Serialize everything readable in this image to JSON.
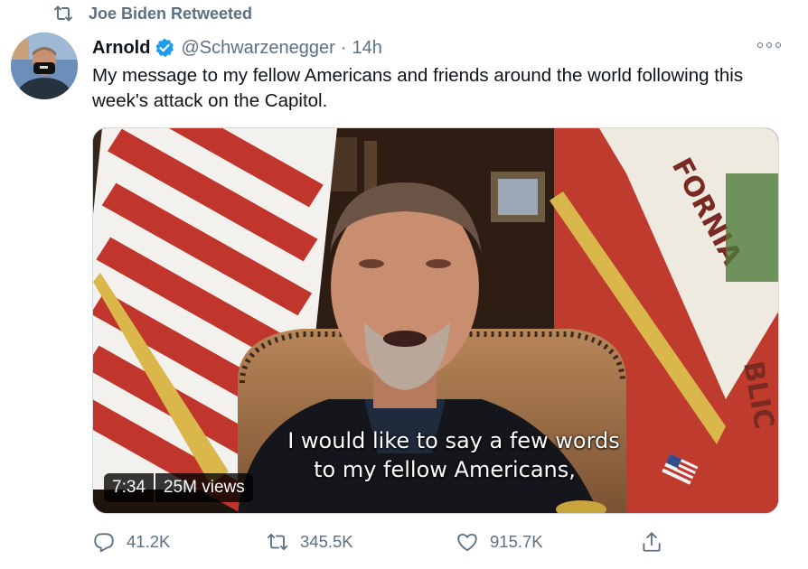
{
  "retweet_context": {
    "icon": "retweet-icon",
    "text": "Joe Biden Retweeted"
  },
  "tweet": {
    "display_name": "Arnold",
    "verified": true,
    "handle": "@Schwarzenegger",
    "separator": "·",
    "time": "14h",
    "text": "My message to my fellow Americans and friends around the world following this week's attack on the Capitol."
  },
  "video": {
    "subtitle_line1": "I would like to say a few words",
    "subtitle_line2": "to my fellow Americans,",
    "flag_banner_text": "FORNIA",
    "flag_banner_text2": "BLIC",
    "duration": "7:34",
    "views": "25M views"
  },
  "actions": {
    "replies": "41.2K",
    "retweets": "345.5K",
    "likes": "915.7K"
  },
  "colors": {
    "accent": "#1d9bf0",
    "muted": "#5b7083"
  }
}
